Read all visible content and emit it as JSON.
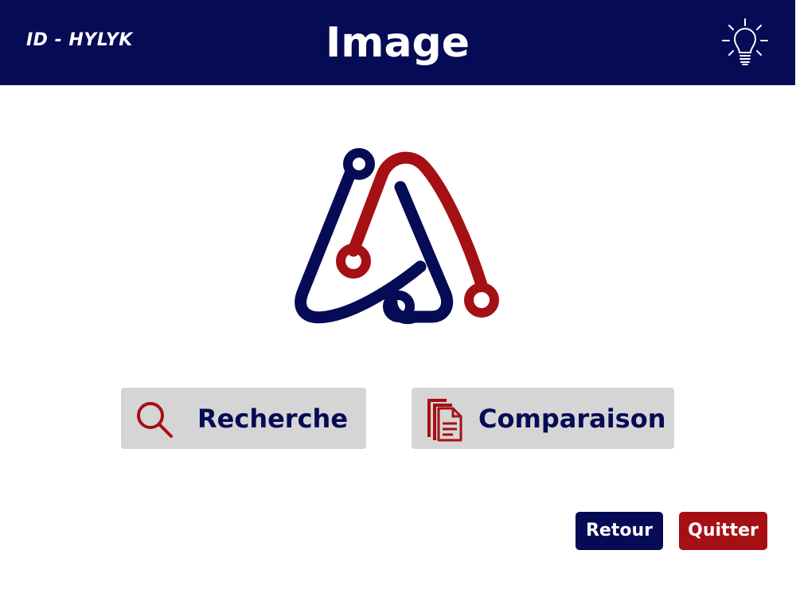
{
  "header": {
    "app_id": "ID - HYLYK",
    "title": "Image",
    "help_icon": "lightbulb-icon"
  },
  "logo": {
    "icon": "app-logo",
    "primary_color": "#060b55",
    "accent_color": "#a51015"
  },
  "actions": {
    "search": {
      "label": "Recherche",
      "icon": "search-icon"
    },
    "compare": {
      "label": "Comparaison",
      "icon": "documents-icon"
    }
  },
  "footer": {
    "back_label": "Retour",
    "quit_label": "Quitter"
  },
  "colors": {
    "navy": "#060b55",
    "red": "#a51015",
    "button_gray": "#d5d5d5",
    "background": "#ffffff"
  }
}
